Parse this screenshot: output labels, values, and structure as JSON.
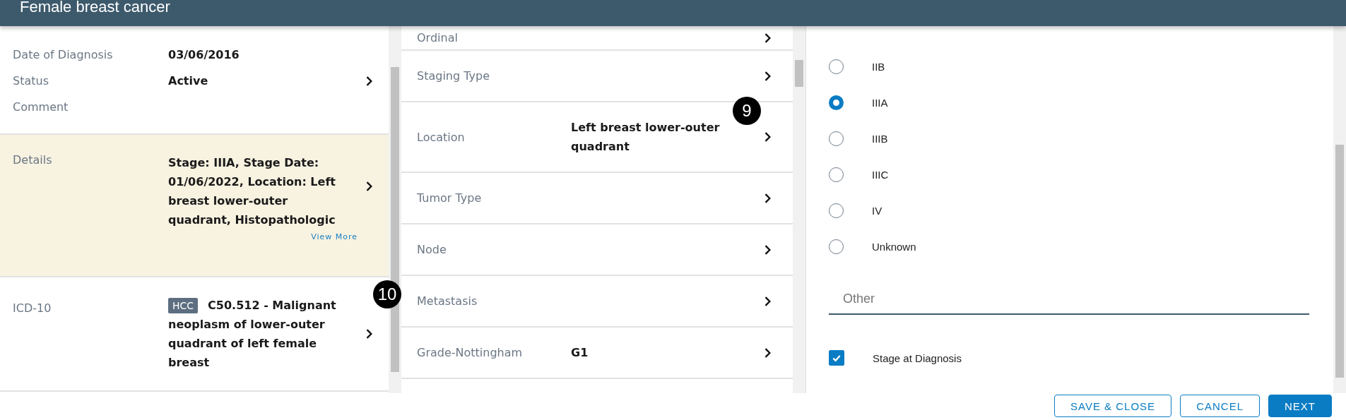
{
  "header": {
    "title": "Female breast cancer"
  },
  "summary": {
    "fields": [
      {
        "label": "Date of Diagnosis",
        "value": "03/06/2016"
      },
      {
        "label": "Status",
        "value": "Active"
      },
      {
        "label": "Comment"
      }
    ]
  },
  "details": {
    "label": "Details",
    "text": "Stage: IIIA, Stage Date: 01/06/2022, Location: Left breast lower-outer quadrant, Histopathologic",
    "link": "View More",
    "highlighted": true
  },
  "icd": {
    "label": "ICD-10",
    "badge": "HCC",
    "text": "C50.512 - Malignant neoplasm of lower-outer quadrant of left female breast",
    "marker": "10"
  },
  "staging_fields": [
    {
      "label": "Ordinal"
    },
    {
      "label": "Staging Type"
    },
    {
      "label": "Location",
      "value": "Left breast lower-outer quadrant",
      "marker": "9"
    },
    {
      "label": "Tumor Type"
    },
    {
      "label": "Node"
    },
    {
      "label": "Metastasis"
    },
    {
      "label": "Grade-Nottingham",
      "value": "G1"
    }
  ],
  "stage_options": [
    {
      "label": "IIB",
      "selected": false
    },
    {
      "label": "IIIA",
      "selected": true
    },
    {
      "label": "IIIB",
      "selected": false
    },
    {
      "label": "IIIC",
      "selected": false
    },
    {
      "label": "IV",
      "selected": false
    },
    {
      "label": "Unknown",
      "selected": false
    }
  ],
  "other_field": {
    "placeholder": "Other"
  },
  "stage_at_diagnosis": {
    "label": "Stage at Diagnosis",
    "checked": true
  },
  "buttons": [
    {
      "label": "SAVE & CLOSE",
      "kind": "outline"
    },
    {
      "label": "CANCEL",
      "kind": "outline"
    },
    {
      "label": "NEXT",
      "kind": "primary"
    }
  ]
}
